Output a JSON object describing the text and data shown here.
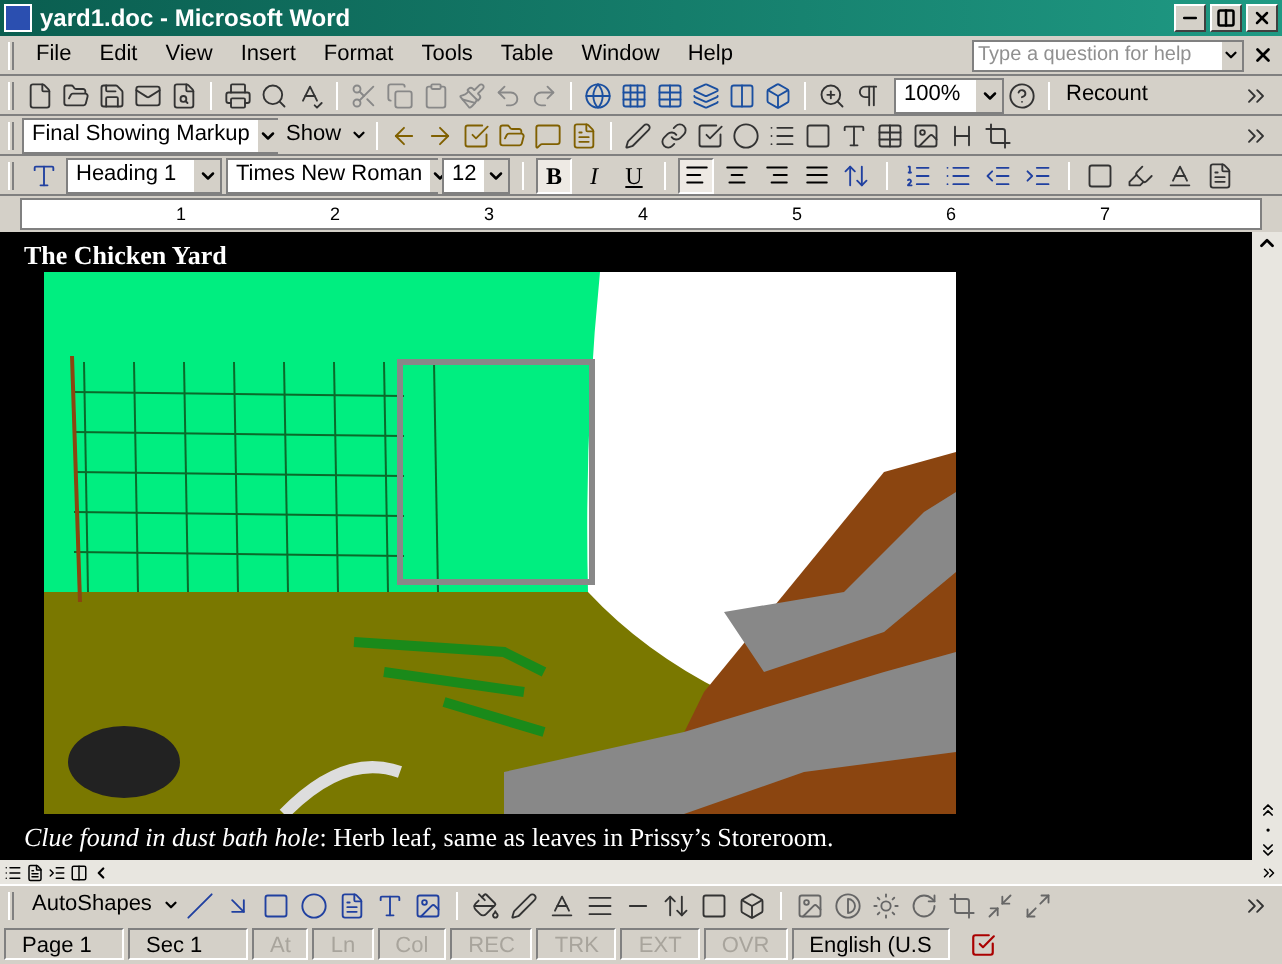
{
  "window": {
    "title": "yard1.doc - Microsoft Word"
  },
  "menu": [
    "File",
    "Edit",
    "View",
    "Insert",
    "Format",
    "Tools",
    "Table",
    "Window",
    "Help"
  ],
  "help_search": {
    "placeholder": "Type a question for help"
  },
  "standard_toolbar": {
    "zoom": "100%",
    "recount": "Recount"
  },
  "reviewing_toolbar": {
    "display": "Final Showing Markup",
    "show": "Show"
  },
  "formatting_toolbar": {
    "style": "Heading 1",
    "font": "Times New Roman",
    "size": "12",
    "format_buttons": [
      {
        "label": "B",
        "selected": true
      },
      {
        "label": "I",
        "selected": false
      },
      {
        "label": "U",
        "selected": false
      }
    ],
    "alignment_buttons": [
      {
        "selected": true
      },
      {
        "selected": false
      },
      {
        "selected": false
      },
      {
        "selected": false
      }
    ]
  },
  "ruler": [
    "1",
    "2",
    "3",
    "4",
    "5",
    "6",
    "7"
  ],
  "document": {
    "heading": "The Chicken Yard",
    "caption": "*Clue found in dust bath hole*: Herb leaf, same as leaves in Prissy’s Storeroom."
  },
  "drawing_toolbar": {
    "autoshapes": "AutoShapes"
  },
  "status_bar": [
    {
      "label": "Page 1",
      "disabled": false
    },
    {
      "label": "Sec 1",
      "disabled": false
    },
    {
      "label": "At",
      "disabled": true
    },
    {
      "label": "Ln",
      "disabled": true
    },
    {
      "label": "Col",
      "disabled": true
    },
    {
      "label": "REC",
      "disabled": true
    },
    {
      "label": "TRK",
      "disabled": true
    },
    {
      "label": "EXT",
      "disabled": true
    },
    {
      "label": "OVR",
      "disabled": true
    },
    {
      "label": "English (U.S",
      "disabled": false
    }
  ]
}
